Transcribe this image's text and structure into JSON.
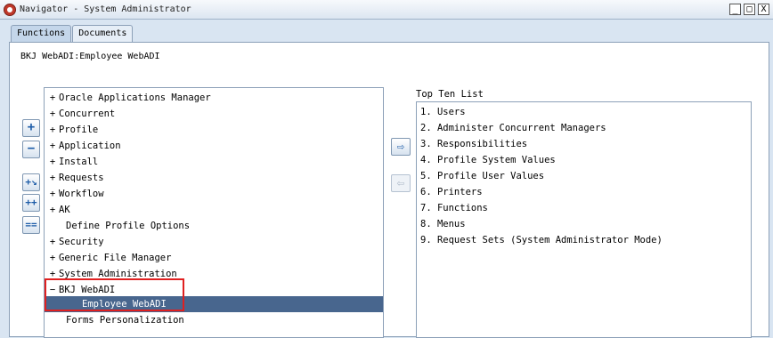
{
  "window": {
    "title": "Navigator - System Administrator",
    "minimize_glyph": "_",
    "maximize_glyph": "□",
    "close_glyph": "X"
  },
  "tabs": [
    {
      "label": "Functions",
      "active": true
    },
    {
      "label": "Documents",
      "active": false
    }
  ],
  "path_label": "BKJ WebADI:Employee WebADI",
  "side_buttons": {
    "expand": "+",
    "collapse": "−",
    "expand_branch": "+↘",
    "expand_all": "++",
    "collapse_all": "=="
  },
  "tree": [
    {
      "exp": "+",
      "label": "Oracle Applications Manager",
      "selected": false
    },
    {
      "exp": "+",
      "label": "Concurrent",
      "selected": false
    },
    {
      "exp": "+",
      "label": "Profile",
      "selected": false
    },
    {
      "exp": "+",
      "label": "Application",
      "selected": false
    },
    {
      "exp": "+",
      "label": "Install",
      "selected": false
    },
    {
      "exp": "+",
      "label": "Requests",
      "selected": false
    },
    {
      "exp": "+",
      "label": "Workflow",
      "selected": false
    },
    {
      "exp": "+",
      "label": "AK",
      "selected": false
    },
    {
      "exp": "",
      "label": "Define Profile Options",
      "selected": false
    },
    {
      "exp": "+",
      "label": "Security",
      "selected": false
    },
    {
      "exp": "+",
      "label": "Generic File Manager",
      "selected": false
    },
    {
      "exp": "+",
      "label": "System Administration",
      "selected": false
    },
    {
      "exp": "−",
      "label": "BKJ WebADI",
      "selected": false
    },
    {
      "exp": "",
      "label": "Employee WebADI",
      "selected": true
    },
    {
      "exp": "",
      "label": "Forms Personalization",
      "selected": false
    }
  ],
  "transfer": {
    "add": "⇨",
    "remove": "⇦"
  },
  "top_ten": {
    "label": "Top Ten List",
    "items": [
      "1. Users",
      "2. Administer Concurrent Managers",
      "3. Responsibilities",
      "4. Profile System Values",
      "5. Profile User Values",
      "6. Printers",
      "7. Functions",
      "8. Menus",
      "9. Request Sets (System Administrator Mode)"
    ]
  },
  "colors": {
    "selection": "#48668e",
    "highlight": "#e02020",
    "background": "#d9e5f2"
  }
}
